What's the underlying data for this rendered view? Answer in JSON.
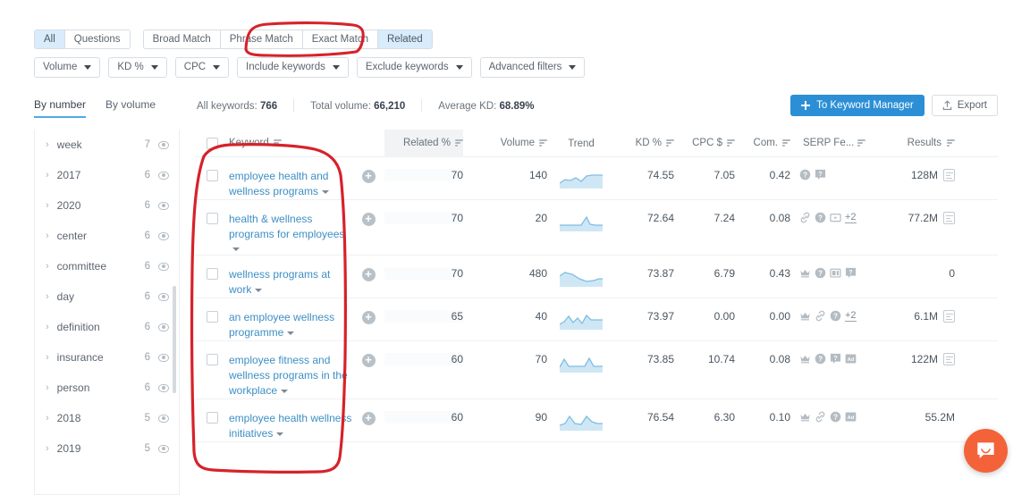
{
  "filters": {
    "match_tabs": [
      {
        "label": "All",
        "active": true
      },
      {
        "label": "Questions",
        "active": false
      }
    ],
    "match_tabs2": [
      {
        "label": "Broad Match",
        "active": false
      },
      {
        "label": "Phrase Match",
        "active": false
      },
      {
        "label": "Exact Match",
        "active": false
      },
      {
        "label": "Related",
        "active": true
      }
    ],
    "dropdowns": [
      {
        "label": "Volume"
      },
      {
        "label": "KD %"
      },
      {
        "label": "CPC"
      },
      {
        "label": "Include keywords"
      },
      {
        "label": "Exclude keywords"
      },
      {
        "label": "Advanced filters"
      }
    ]
  },
  "stats": {
    "by_tabs": [
      {
        "label": "By number",
        "active": true
      },
      {
        "label": "By volume",
        "active": false
      }
    ],
    "all_keywords_label": "All keywords:",
    "all_keywords_value": "766",
    "total_volume_label": "Total volume:",
    "total_volume_value": "66,210",
    "average_kd_label": "Average KD:",
    "average_kd_value": "68.89%",
    "keyword_manager_button": "To Keyword Manager",
    "export_button": "Export"
  },
  "sidebar": {
    "items": [
      {
        "label": "week",
        "count": "7"
      },
      {
        "label": "2017",
        "count": "6"
      },
      {
        "label": "2020",
        "count": "6"
      },
      {
        "label": "center",
        "count": "6"
      },
      {
        "label": "committee",
        "count": "6"
      },
      {
        "label": "day",
        "count": "6"
      },
      {
        "label": "definition",
        "count": "6"
      },
      {
        "label": "insurance",
        "count": "6"
      },
      {
        "label": "person",
        "count": "6"
      },
      {
        "label": "2018",
        "count": "5"
      },
      {
        "label": "2019",
        "count": "5"
      }
    ]
  },
  "table": {
    "columns": [
      {
        "label": "Keyword",
        "sortable": true,
        "highlight": false
      },
      {
        "label": "Related %",
        "sortable": true,
        "highlight": true
      },
      {
        "label": "Volume",
        "sortable": true,
        "highlight": false
      },
      {
        "label": "Trend",
        "sortable": false,
        "highlight": false
      },
      {
        "label": "KD %",
        "sortable": true,
        "highlight": false
      },
      {
        "label": "CPC $",
        "sortable": true,
        "highlight": false
      },
      {
        "label": "Com.",
        "sortable": true,
        "highlight": false
      },
      {
        "label": "SERP Fe...",
        "sortable": true,
        "highlight": false
      },
      {
        "label": "Results",
        "sortable": true,
        "highlight": false
      }
    ],
    "rows": [
      {
        "keyword": "employee health and wellness programs",
        "related": "70",
        "volume": "140",
        "kd": "74.55",
        "cpc": "7.05",
        "com": "0.42",
        "serp_icons": [
          "question-circle",
          "question-box"
        ],
        "serp_more": "",
        "results": "128M",
        "has_doc_icon": true,
        "spark": "0,14 6,10 12,11 18,8 24,12 30,6 36,5 42,5 48,5"
      },
      {
        "keyword": "health & wellness programs for employees",
        "related": "70",
        "volume": "20",
        "kd": "72.64",
        "cpc": "7.24",
        "com": "0.08",
        "serp_icons": [
          "link",
          "question-circle",
          "video"
        ],
        "serp_more": "+2",
        "results": "77.2M",
        "has_doc_icon": true,
        "spark": "0,13 8,13 16,13 24,13 30,4 34,12 40,13 48,13"
      },
      {
        "keyword": "wellness programs at work",
        "related": "70",
        "volume": "480",
        "kd": "73.87",
        "cpc": "6.79",
        "com": "0.43",
        "serp_icons": [
          "crown",
          "question-circle",
          "image",
          "question-box"
        ],
        "serp_more": "",
        "results": "0",
        "has_doc_icon": false,
        "spark": "0,8 6,4 14,6 22,11 30,14 38,13 44,11 48,11"
      },
      {
        "keyword": "an employee wellness programme",
        "related": "65",
        "volume": "40",
        "kd": "73.97",
        "cpc": "0.00",
        "com": "0.00",
        "serp_icons": [
          "crown",
          "link",
          "question-circle"
        ],
        "serp_more": "+2",
        "results": "6.1M",
        "has_doc_icon": true,
        "spark": "0,14 5,11 10,5 15,12 20,7 25,13 30,4 35,9 40,9 48,9"
      },
      {
        "keyword": "employee fitness and wellness programs in the workplace",
        "related": "60",
        "volume": "70",
        "kd": "73.85",
        "cpc": "10.74",
        "com": "0.08",
        "serp_icons": [
          "crown",
          "question-circle",
          "question-box",
          "ad"
        ],
        "serp_more": "",
        "results": "122M",
        "has_doc_icon": true,
        "spark": "0,14 5,5 10,13 20,13 28,13 33,4 38,13 48,13"
      },
      {
        "keyword": "employee health wellness initiatives",
        "related": "60",
        "volume": "90",
        "kd": "76.54",
        "cpc": "6.30",
        "com": "0.10",
        "serp_icons": [
          "crown",
          "link",
          "question-circle",
          "ad"
        ],
        "serp_more": "",
        "results": "55.2M",
        "has_doc_icon": false,
        "spark": "0,14 6,12 11,4 17,12 24,13 30,4 36,10 42,12 48,12"
      }
    ]
  },
  "colors": {
    "accent_blue": "#2c8fd6",
    "active_tab_bg": "#d8ecfb",
    "keyword_link": "#3d8fc4",
    "annotation_red": "#d6222a",
    "intercom_orange": "#f4623a",
    "spark_fill": "#cfe7f5",
    "spark_stroke": "#7dbde4"
  },
  "intercom": {
    "label": "chat-launcher"
  }
}
